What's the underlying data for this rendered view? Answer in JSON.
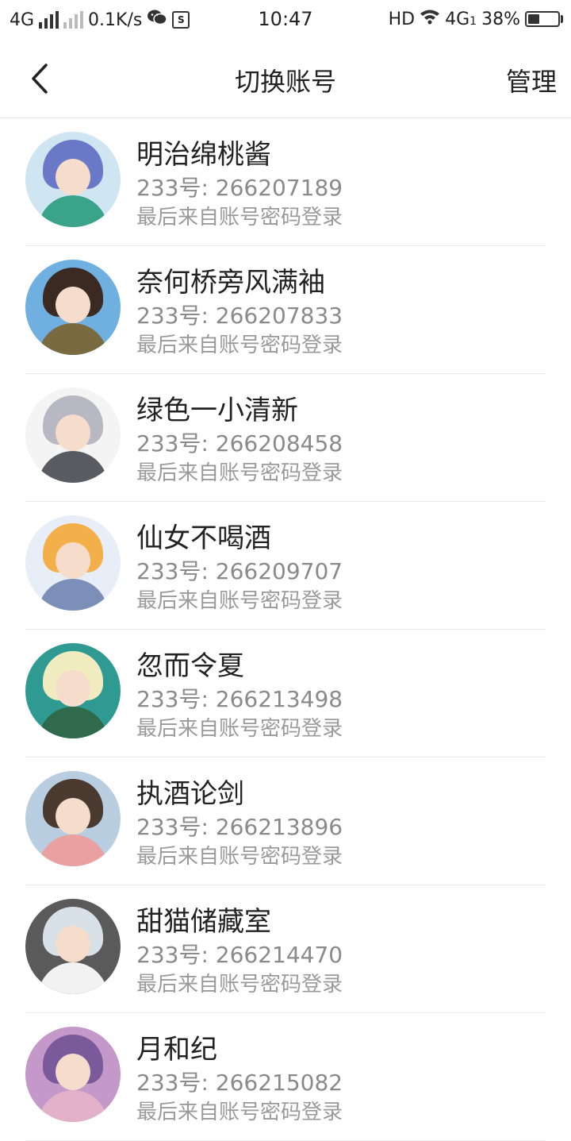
{
  "status_bar": {
    "network_1": "4G",
    "speed": "0.1K/s",
    "wechat_icon": "wechat-icon",
    "sim_icon": "S",
    "time": "10:47",
    "hd": "HD",
    "network_2": "4G",
    "network_2_sub": "1",
    "battery_percent": "38%",
    "battery_level": 0.38
  },
  "header": {
    "back_icon": "chevron-left-icon",
    "title": "切换账号",
    "manage_label": "管理"
  },
  "accounts": [
    {
      "name": "明治绵桃酱",
      "id_text": "233号: 266207189",
      "source": "最后来自账号密码登录",
      "bg": "#cfe6f2",
      "hair": "#6a78c8",
      "body": "#3aa38a"
    },
    {
      "name": "奈何桥旁风满袖",
      "id_text": "233号: 266207833",
      "source": "最后来自账号密码登录",
      "bg": "#6fb0e0",
      "hair": "#3a2a22",
      "body": "#7a6a40"
    },
    {
      "name": "绿色一小清新",
      "id_text": "233号: 266208458",
      "source": "最后来自账号密码登录",
      "bg": "#f4f4f4",
      "hair": "#b8b8c4",
      "body": "#5a5a62"
    },
    {
      "name": "仙女不喝酒",
      "id_text": "233号: 266209707",
      "source": "最后来自账号密码登录",
      "bg": "#e8eef8",
      "hair": "#f3b04a",
      "body": "#7b8fb8"
    },
    {
      "name": "忽而令夏",
      "id_text": "233号: 266213498",
      "source": "最后来自账号密码登录",
      "bg": "#2f9a92",
      "hair": "#f1ecc0",
      "body": "#2f6a4a"
    },
    {
      "name": "执酒论剑",
      "id_text": "233号: 266213896",
      "source": "最后来自账号密码登录",
      "bg": "#b9cde0",
      "hair": "#4a3a30",
      "body": "#e8a0a0"
    },
    {
      "name": "甜猫储藏室",
      "id_text": "233号: 266214470",
      "source": "最后来自账号密码登录",
      "bg": "#5a5a5a",
      "hair": "#d8e0e8",
      "body": "#f2f2f2"
    },
    {
      "name": "月和纪",
      "id_text": "233号: 266215082",
      "source": "最后来自账号密码登录",
      "bg": "#c498c8",
      "hair": "#7a5a9a",
      "body": "#e2b0c8"
    }
  ]
}
